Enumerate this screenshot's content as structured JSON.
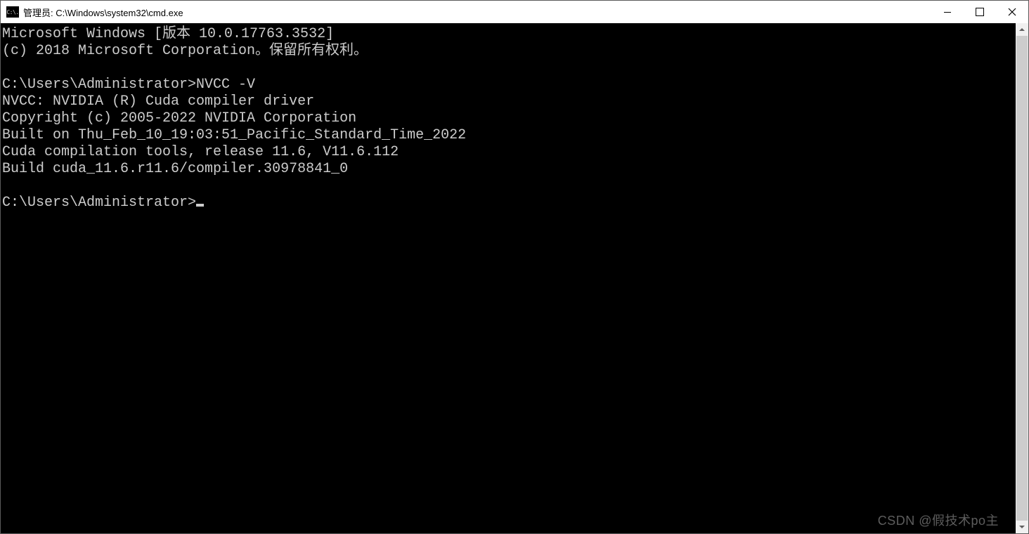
{
  "titlebar": {
    "icon_text": "C:\\.",
    "title": "管理员: C:\\Windows\\system32\\cmd.exe"
  },
  "terminal": {
    "lines": [
      "Microsoft Windows [版本 10.0.17763.3532]",
      "(c) 2018 Microsoft Corporation。保留所有权利。",
      "",
      "C:\\Users\\Administrator>NVCC -V",
      "NVCC: NVIDIA (R) Cuda compiler driver",
      "Copyright (c) 2005-2022 NVIDIA Corporation",
      "Built on Thu_Feb_10_19:03:51_Pacific_Standard_Time_2022",
      "Cuda compilation tools, release 11.6, V11.6.112",
      "Build cuda_11.6.r11.6/compiler.30978841_0",
      "",
      "C:\\Users\\Administrator>"
    ]
  },
  "watermark": "CSDN @假技术po主"
}
